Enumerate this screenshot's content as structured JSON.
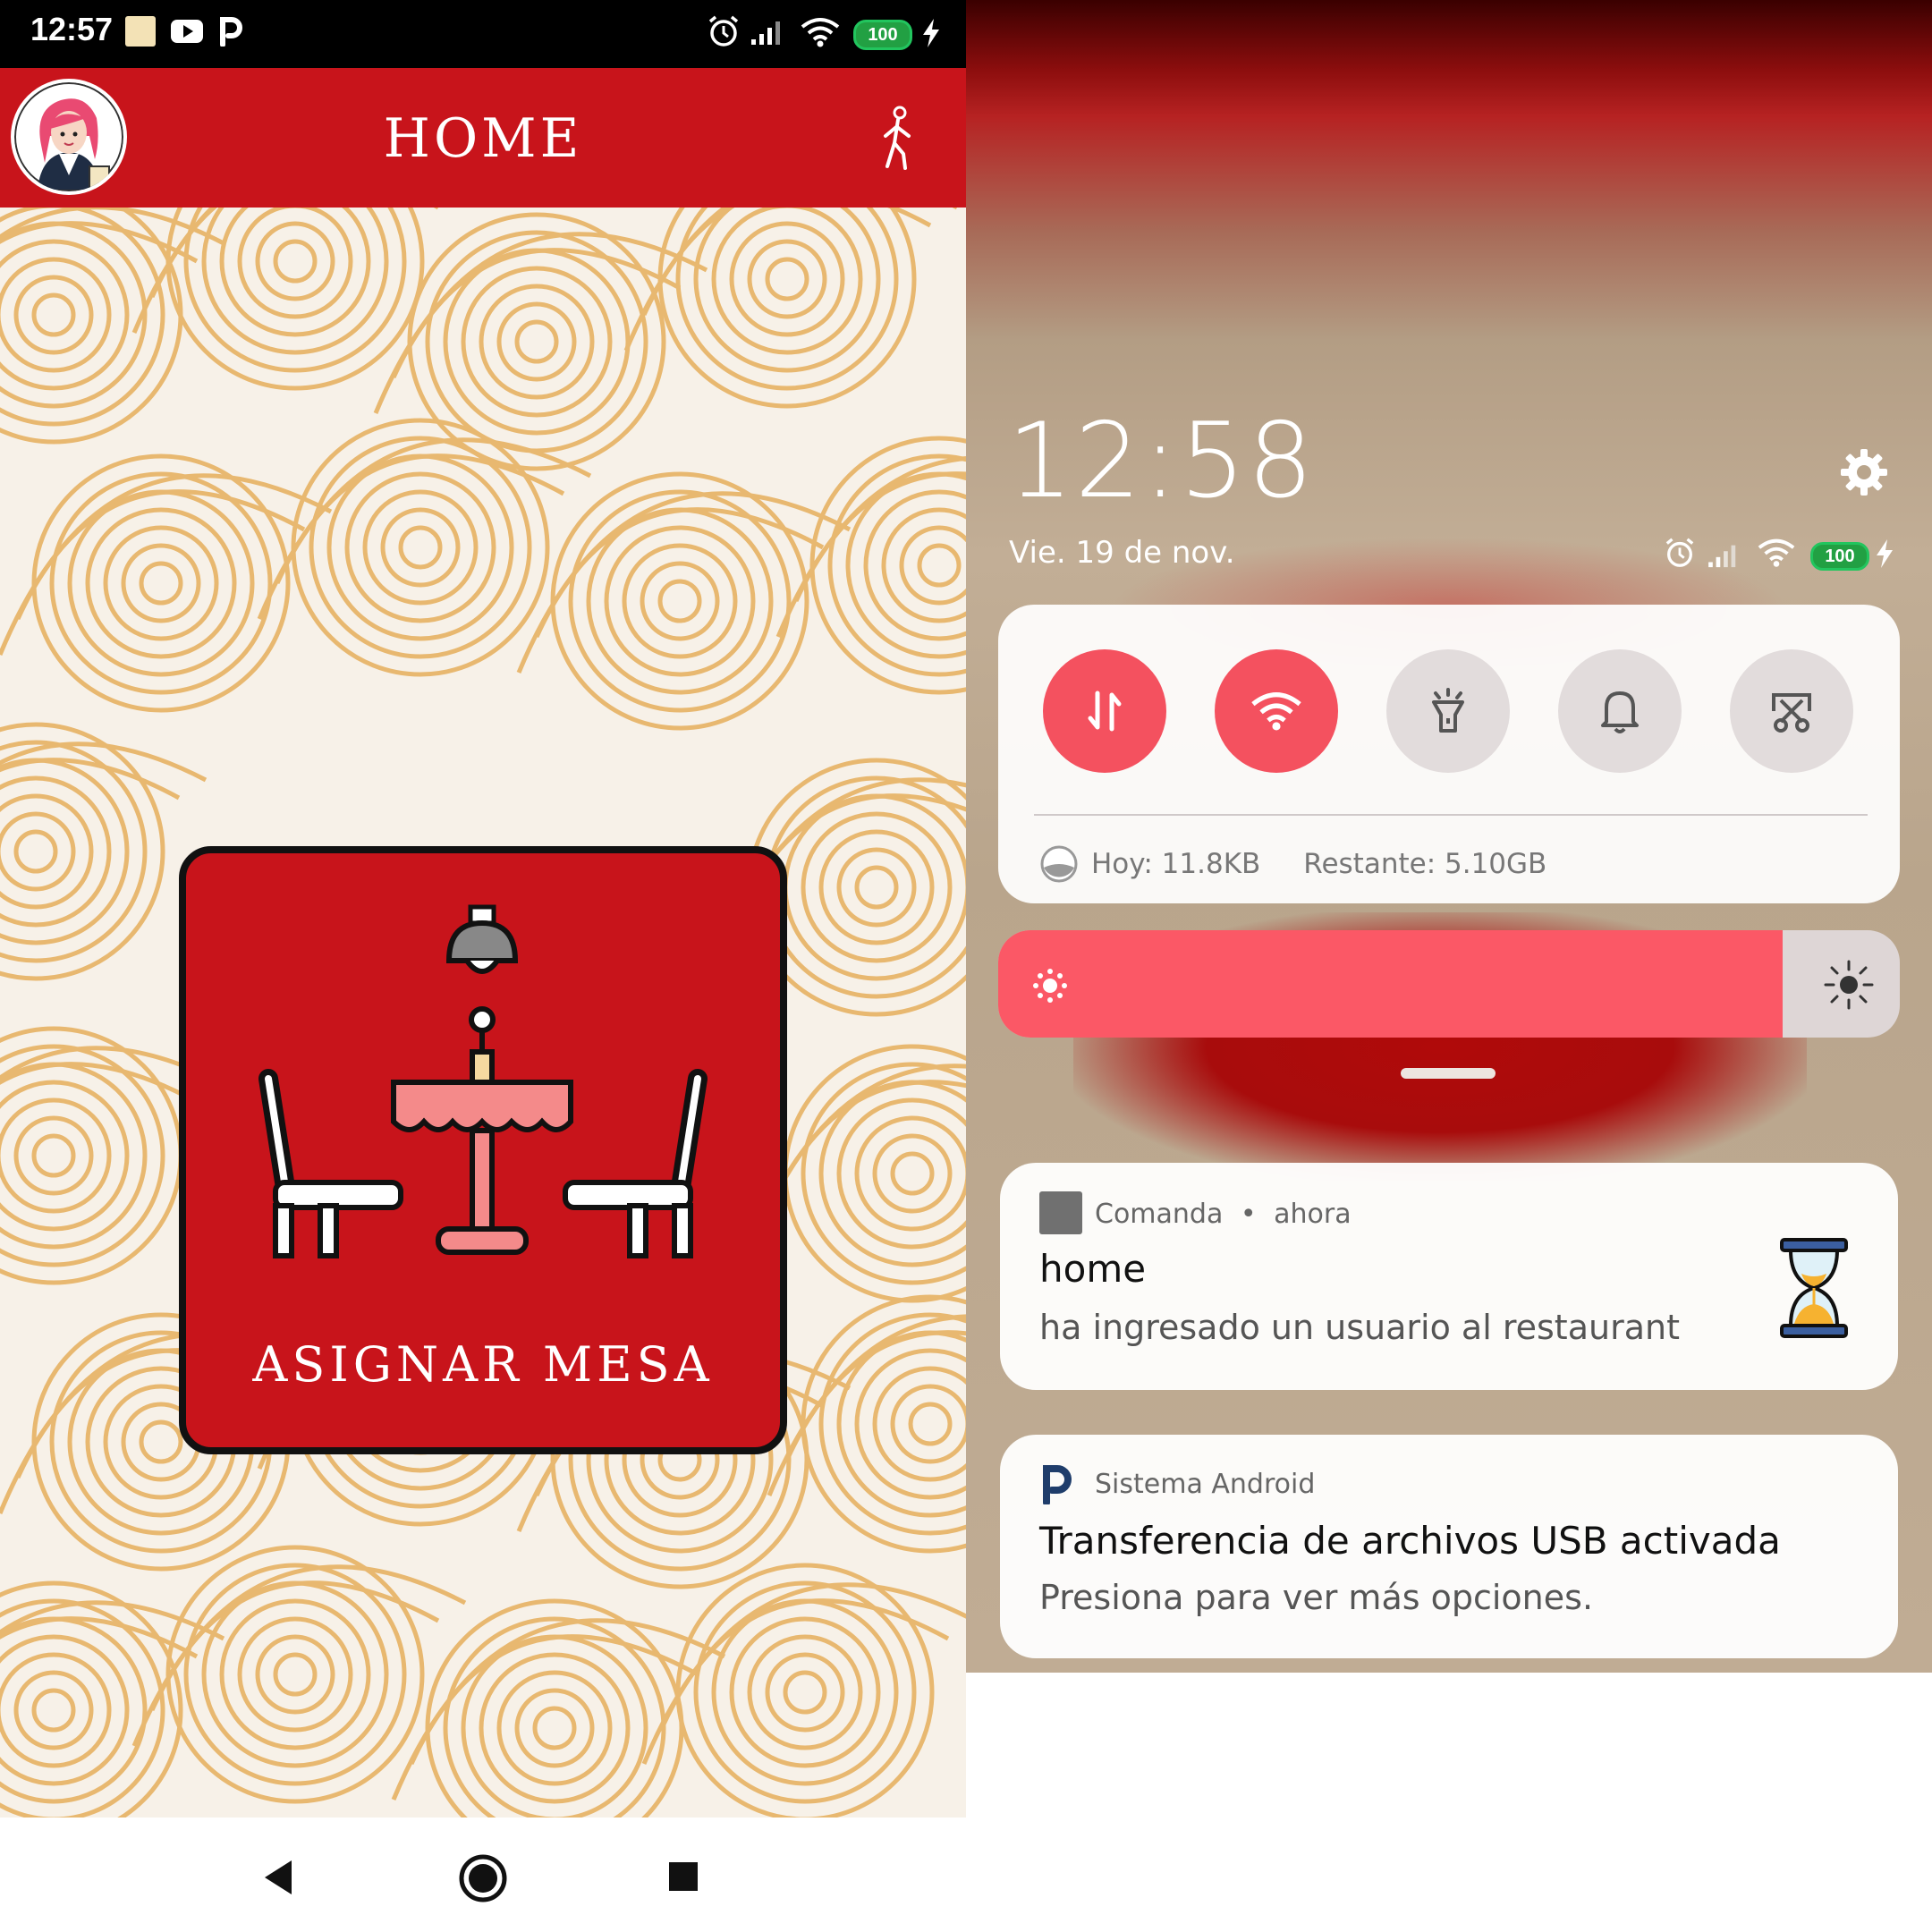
{
  "left_phone": {
    "status_bar": {
      "time": "12:57",
      "battery": "100"
    },
    "app_bar": {
      "title": "HOME"
    },
    "card": {
      "label": "ASIGNAR MESA"
    }
  },
  "right_phone": {
    "clock": "12:58",
    "date": "Vie. 19 de nov.",
    "status_battery": "100",
    "quick_settings": {
      "toggles": [
        {
          "name": "mobile-data",
          "state": "on"
        },
        {
          "name": "wifi",
          "state": "on"
        },
        {
          "name": "flashlight",
          "state": "off"
        },
        {
          "name": "sound",
          "state": "off"
        },
        {
          "name": "screenshot",
          "state": "off"
        }
      ],
      "data_today": "Hoy: 11.8KB",
      "data_remaining": "Restante: 5.10GB"
    },
    "brightness": {
      "level": 0.87
    },
    "notifications": [
      {
        "app": "Comanda",
        "time": "ahora",
        "title": "home",
        "text": "ha ingresado un usuario al restaurant"
      },
      {
        "app": "Sistema Android",
        "title": "Transferencia de archivos USB activada",
        "text": "Presiona para ver más opciones."
      }
    ]
  },
  "colors": {
    "app_red": "#c8141b",
    "toggle_on": "#f4515f",
    "brightness_fill": "#fb5866",
    "wave_pattern": "#e8b870",
    "battery_green": "#22a043"
  }
}
